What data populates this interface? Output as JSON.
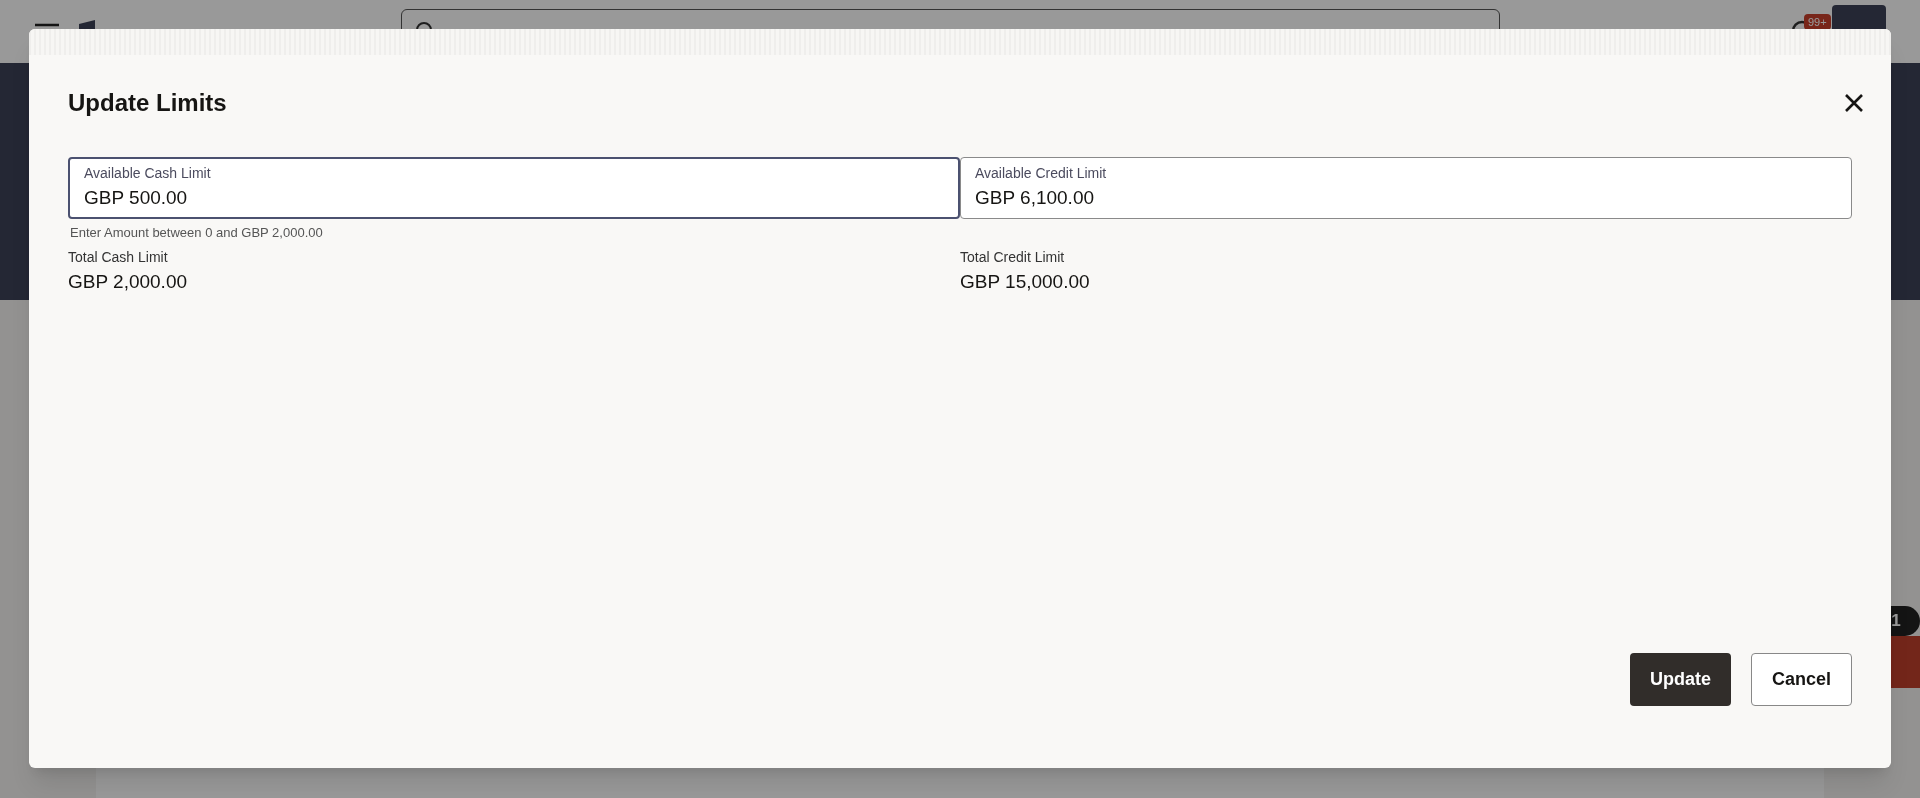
{
  "app_header": {
    "notifications_badge": "99+"
  },
  "side_badge": "1",
  "dialog": {
    "title": "Update Limits",
    "fields": [
      {
        "label": "Available Cash Limit",
        "value": "GBP 500.00",
        "focused": true,
        "hint": "Enter Amount between 0 and GBP 2,000.00"
      },
      {
        "label": "Available Credit Limit",
        "value": "GBP 6,100.00",
        "focused": false
      }
    ],
    "totals": [
      {
        "label": "Total Cash Limit",
        "value": "GBP 2,000.00"
      },
      {
        "label": "Total Credit Limit",
        "value": "GBP 15,000.00"
      }
    ],
    "buttons": [
      {
        "label": "Update",
        "kind": "primary"
      },
      {
        "label": "Cancel",
        "kind": "secondary"
      }
    ]
  }
}
